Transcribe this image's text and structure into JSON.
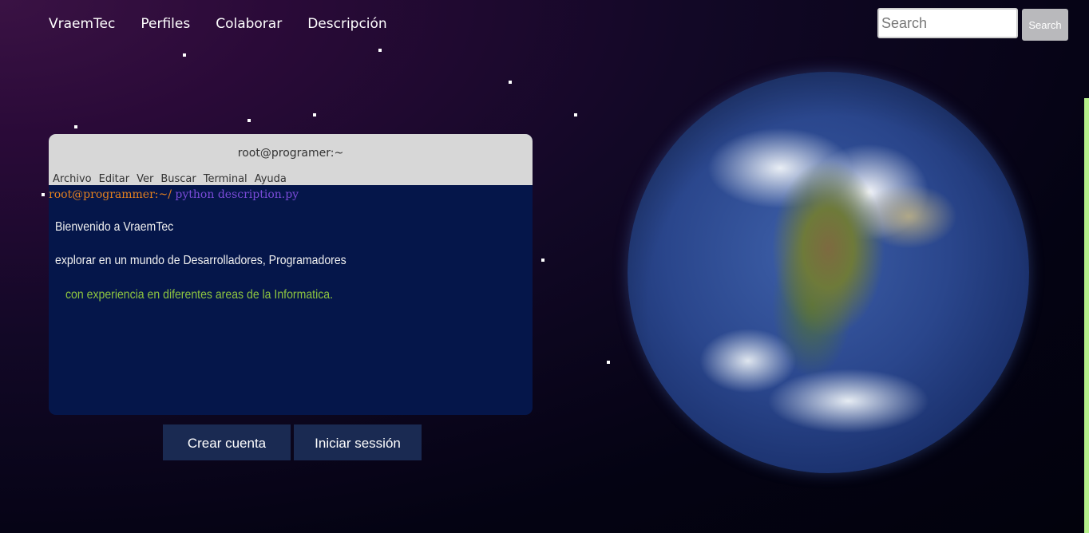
{
  "nav": {
    "brand": "VraemTec",
    "items": [
      "Perfiles",
      "Colaborar",
      "Descripción"
    ]
  },
  "search": {
    "placeholder": "Search",
    "button_label": "Search"
  },
  "terminal": {
    "title": "root@programer:~",
    "menu": [
      "Archivo",
      "Editar",
      "Ver",
      "Buscar",
      "Terminal",
      "Ayuda"
    ],
    "prompt_user": "root@programmer:~/",
    "prompt_command": "python description.py",
    "lines": [
      "Bienvenido a VraemTec",
      "explorar en un mundo de Desarrolladores, Programadores",
      "con experiencia en diferentes areas de la Informatica."
    ]
  },
  "buttons": {
    "create_account": "Crear cuenta",
    "login": "Iniciar sessión"
  },
  "colors": {
    "terminal_bg": "#05164a",
    "prompt_user": "#e3801f",
    "prompt_command": "#7a4bd8",
    "highlight_line": "#8ec63f",
    "button_bg": "#1a2a52"
  }
}
